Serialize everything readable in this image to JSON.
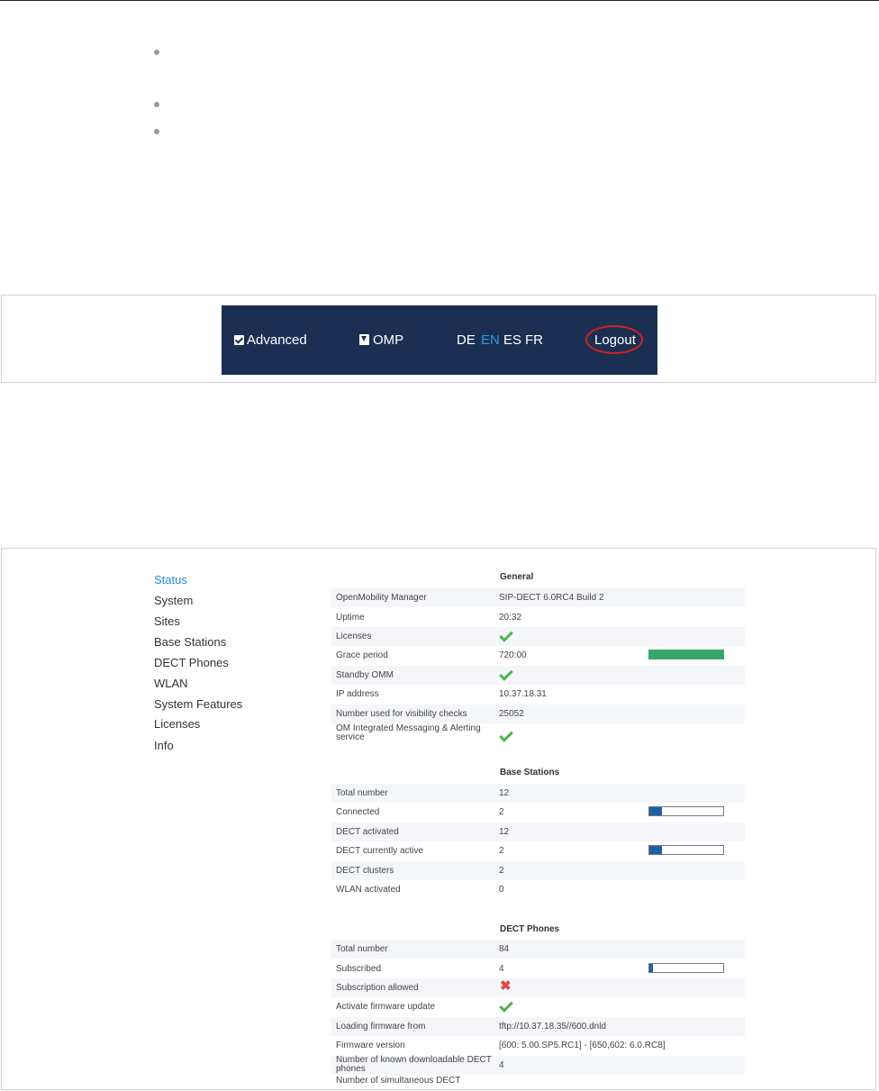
{
  "header": {
    "advanced_label": "Advanced",
    "omp_label": "OMP",
    "languages": [
      "DE",
      "EN",
      "ES",
      "FR"
    ],
    "active_language": "EN",
    "logout_label": "Logout"
  },
  "sidebar": {
    "items": [
      "Status",
      "System",
      "Sites",
      "Base Stations",
      "DECT Phones",
      "WLAN",
      "System Features",
      "Licenses",
      "Info"
    ],
    "active": "Status"
  },
  "general": {
    "title": "General",
    "rows": {
      "omm": {
        "label": "OpenMobility Manager",
        "value": "SIP-DECT 6.0RC4 Build 2"
      },
      "uptime": {
        "label": "Uptime",
        "value": "20:32"
      },
      "licenses": {
        "label": "Licenses",
        "icon": "check-icon"
      },
      "grace": {
        "label": "Grace period",
        "value": "720:00",
        "level_percent": 100
      },
      "standby": {
        "label": "Standby OMM",
        "icon": "check-icon"
      },
      "ip": {
        "label": "IP address",
        "value": "10.37.18.31"
      },
      "visibility": {
        "label": "Number used for visibility checks",
        "value": "25052"
      },
      "messaging": {
        "label": "OM Integrated Messaging & Alerting service",
        "icon": "check-icon"
      }
    }
  },
  "base_stations": {
    "title": "Base Stations",
    "rows": {
      "total": {
        "label": "Total number",
        "value": "12"
      },
      "connected": {
        "label": "Connected",
        "value": "2",
        "level_percent": 17
      },
      "dect_activated": {
        "label": "DECT activated",
        "value": "12"
      },
      "dect_active": {
        "label": "DECT currently active",
        "value": "2",
        "level_percent": 17
      },
      "clusters": {
        "label": "DECT clusters",
        "value": "2"
      },
      "wlan": {
        "label": "WLAN activated",
        "value": "0"
      }
    }
  },
  "dect_phones": {
    "title": "DECT Phones",
    "rows": {
      "total": {
        "label": "Total number",
        "value": "84"
      },
      "subscribed": {
        "label": "Subscribed",
        "value": "4",
        "level_percent": 5
      },
      "sub_allowed": {
        "label": "Subscription allowed",
        "icon": "cross-icon"
      },
      "fw_update": {
        "label": "Activate firmware update",
        "icon": "check-icon"
      },
      "loading_fw": {
        "label": "Loading firmware from",
        "value": "tftp://10.37.18.35//600.dnld"
      },
      "fw_version": {
        "label": "Firmware version",
        "value": "[600: 5.00.SP5.RC1] - [650,602: 6.0.RC8]"
      },
      "known_fw": {
        "label": "Number of known downloadable DECT phones",
        "value": "4"
      },
      "cut_off": {
        "label": "Number of simultaneous DECT"
      }
    }
  },
  "colors": {
    "navbar_bg": "#1b2f52",
    "active_lang": "#2c98e0",
    "logout_highlight": "#d0211b",
    "sidebar_active": "#2a8ad4",
    "bar_fill": "#1f5fa8",
    "bar_full": "#3aa56a",
    "check": "#4fb34a",
    "cross": "#e04848"
  }
}
